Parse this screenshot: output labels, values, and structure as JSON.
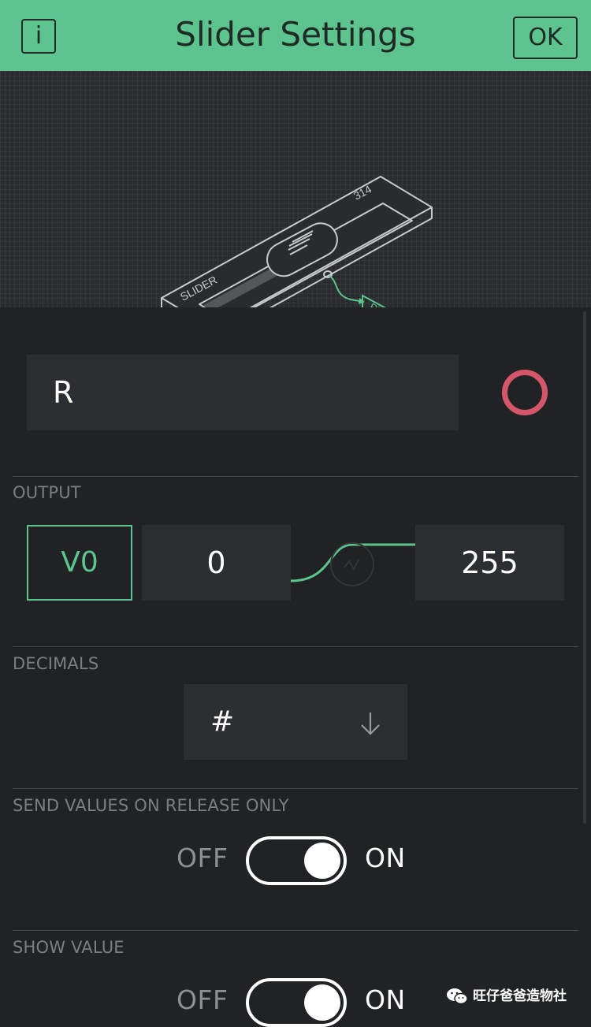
{
  "header": {
    "title": "Slider Settings",
    "info_label": "i",
    "ok_label": "OK"
  },
  "illustration": {
    "slider_text": "SLIDER",
    "value_text": "314",
    "pin_text": "PIN"
  },
  "name_field": {
    "value": "R",
    "color": "#d5566a"
  },
  "output": {
    "label": "OUTPUT",
    "pin": "V0",
    "min": "0",
    "max": "255"
  },
  "decimals": {
    "label": "DECIMALS",
    "selected": "#"
  },
  "send_on_release": {
    "label": "SEND VALUES ON RELEASE ONLY",
    "off_label": "OFF",
    "on_label": "ON",
    "state": "ON"
  },
  "show_value": {
    "label": "SHOW VALUE",
    "off_label": "OFF",
    "on_label": "ON",
    "state": "ON"
  },
  "watermark": {
    "text": "旺仔爸爸造物社"
  },
  "colors": {
    "accent": "#5dc48f",
    "background": "#212224",
    "field": "#2d2e31"
  }
}
